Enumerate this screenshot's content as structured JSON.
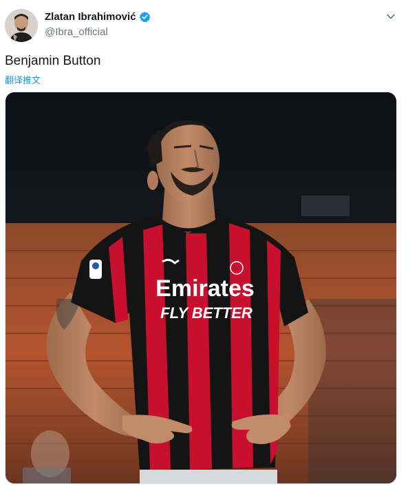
{
  "author": {
    "display_name": "Zlatan Ibrahimović",
    "handle": "@Ibra_official",
    "verified_color": "#1da1f2"
  },
  "tweet": {
    "text": "Benjamin Button",
    "translate_label": "翻译推文"
  },
  "photo": {
    "sponsor_main": "Emirates",
    "sponsor_sub": "FLY BETTER",
    "colors": {
      "jersey_red": "#c8102e",
      "jersey_black": "#141414",
      "stand_orange": "#b5542e"
    }
  },
  "icons": {
    "more": "chevron-down-icon",
    "verified": "verified-badge-icon"
  }
}
